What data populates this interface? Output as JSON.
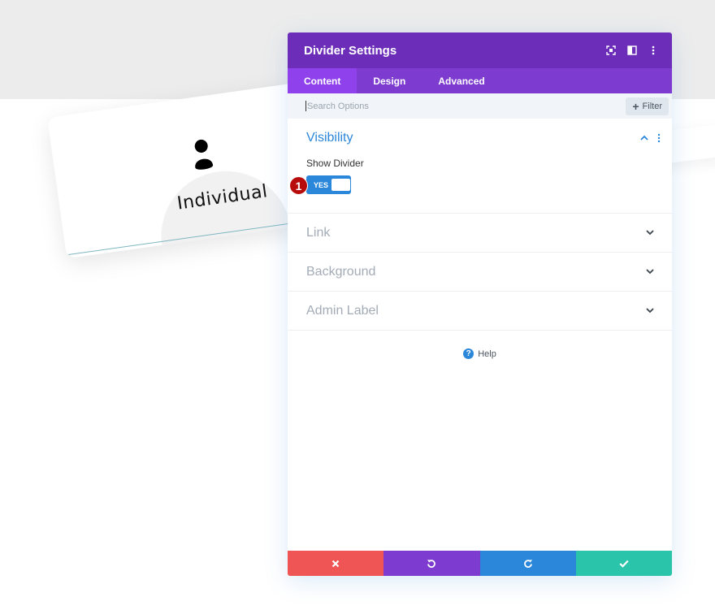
{
  "background_card": {
    "title": "Individual"
  },
  "panel": {
    "title": "Divider Settings",
    "header_icons": [
      "expand-icon",
      "sidebar-layout-icon",
      "more-vertical-icon"
    ],
    "tabs": [
      {
        "label": "Content",
        "active": true
      },
      {
        "label": "Design",
        "active": false
      },
      {
        "label": "Advanced",
        "active": false
      }
    ],
    "search": {
      "placeholder": "Search Options",
      "value": ""
    },
    "filter_label": "Filter",
    "sections": [
      {
        "title": "Visibility",
        "open": true,
        "field_label": "Show Divider",
        "toggle_label": "YES",
        "toggle_on": true,
        "badge": "1"
      },
      {
        "title": "Link",
        "open": false
      },
      {
        "title": "Background",
        "open": false
      },
      {
        "title": "Admin Label",
        "open": false
      }
    ],
    "help_label": "Help",
    "footer_buttons": [
      "close-icon",
      "undo-icon",
      "redo-icon",
      "check-icon"
    ]
  },
  "colors": {
    "header": "#6c2eb9",
    "tabs": "#7d3bcf",
    "active_tab": "#8f42ec",
    "accent_blue": "#2b87da",
    "cancel": "#ef5555",
    "undo": "#7e3bd0",
    "redo": "#2b87da",
    "save": "#29c4a9",
    "badge": "#b80c0c"
  }
}
